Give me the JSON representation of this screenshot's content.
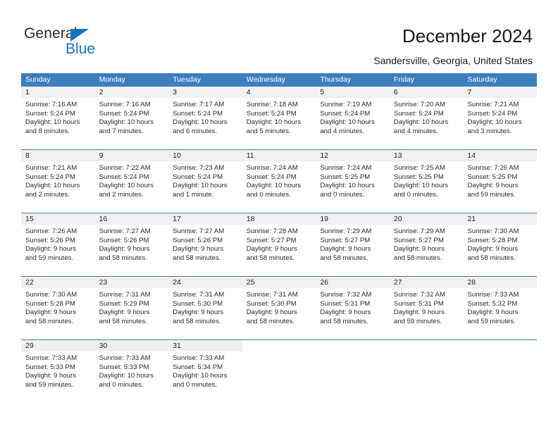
{
  "brand": {
    "name_part1": "General",
    "name_part2": "Blue",
    "logo_icon": "blue-triangle-icon",
    "primary_color": "#1574bb"
  },
  "header": {
    "title": "December 2024",
    "subtitle": "Sandersville, Georgia, United States"
  },
  "calendar": {
    "header_color": "#3d7ebe",
    "daynum_band_color": "#f0f0f0",
    "weekdays": [
      "Sunday",
      "Monday",
      "Tuesday",
      "Wednesday",
      "Thursday",
      "Friday",
      "Saturday"
    ],
    "weeks": [
      [
        {
          "day": "1",
          "sunrise": "Sunrise: 7:16 AM",
          "sunset": "Sunset: 5:24 PM",
          "daylight1": "Daylight: 10 hours",
          "daylight2": "and 8 minutes."
        },
        {
          "day": "2",
          "sunrise": "Sunrise: 7:16 AM",
          "sunset": "Sunset: 5:24 PM",
          "daylight1": "Daylight: 10 hours",
          "daylight2": "and 7 minutes."
        },
        {
          "day": "3",
          "sunrise": "Sunrise: 7:17 AM",
          "sunset": "Sunset: 5:24 PM",
          "daylight1": "Daylight: 10 hours",
          "daylight2": "and 6 minutes."
        },
        {
          "day": "4",
          "sunrise": "Sunrise: 7:18 AM",
          "sunset": "Sunset: 5:24 PM",
          "daylight1": "Daylight: 10 hours",
          "daylight2": "and 5 minutes."
        },
        {
          "day": "5",
          "sunrise": "Sunrise: 7:19 AM",
          "sunset": "Sunset: 5:24 PM",
          "daylight1": "Daylight: 10 hours",
          "daylight2": "and 4 minutes."
        },
        {
          "day": "6",
          "sunrise": "Sunrise: 7:20 AM",
          "sunset": "Sunset: 5:24 PM",
          "daylight1": "Daylight: 10 hours",
          "daylight2": "and 4 minutes."
        },
        {
          "day": "7",
          "sunrise": "Sunrise: 7:21 AM",
          "sunset": "Sunset: 5:24 PM",
          "daylight1": "Daylight: 10 hours",
          "daylight2": "and 3 minutes."
        }
      ],
      [
        {
          "day": "8",
          "sunrise": "Sunrise: 7:21 AM",
          "sunset": "Sunset: 5:24 PM",
          "daylight1": "Daylight: 10 hours",
          "daylight2": "and 2 minutes."
        },
        {
          "day": "9",
          "sunrise": "Sunrise: 7:22 AM",
          "sunset": "Sunset: 5:24 PM",
          "daylight1": "Daylight: 10 hours",
          "daylight2": "and 2 minutes."
        },
        {
          "day": "10",
          "sunrise": "Sunrise: 7:23 AM",
          "sunset": "Sunset: 5:24 PM",
          "daylight1": "Daylight: 10 hours",
          "daylight2": "and 1 minute."
        },
        {
          "day": "11",
          "sunrise": "Sunrise: 7:24 AM",
          "sunset": "Sunset: 5:24 PM",
          "daylight1": "Daylight: 10 hours",
          "daylight2": "and 0 minutes."
        },
        {
          "day": "12",
          "sunrise": "Sunrise: 7:24 AM",
          "sunset": "Sunset: 5:25 PM",
          "daylight1": "Daylight: 10 hours",
          "daylight2": "and 0 minutes."
        },
        {
          "day": "13",
          "sunrise": "Sunrise: 7:25 AM",
          "sunset": "Sunset: 5:25 PM",
          "daylight1": "Daylight: 10 hours",
          "daylight2": "and 0 minutes."
        },
        {
          "day": "14",
          "sunrise": "Sunrise: 7:26 AM",
          "sunset": "Sunset: 5:25 PM",
          "daylight1": "Daylight: 9 hours",
          "daylight2": "and 59 minutes."
        }
      ],
      [
        {
          "day": "15",
          "sunrise": "Sunrise: 7:26 AM",
          "sunset": "Sunset: 5:26 PM",
          "daylight1": "Daylight: 9 hours",
          "daylight2": "and 59 minutes."
        },
        {
          "day": "16",
          "sunrise": "Sunrise: 7:27 AM",
          "sunset": "Sunset: 5:26 PM",
          "daylight1": "Daylight: 9 hours",
          "daylight2": "and 58 minutes."
        },
        {
          "day": "17",
          "sunrise": "Sunrise: 7:27 AM",
          "sunset": "Sunset: 5:26 PM",
          "daylight1": "Daylight: 9 hours",
          "daylight2": "and 58 minutes."
        },
        {
          "day": "18",
          "sunrise": "Sunrise: 7:28 AM",
          "sunset": "Sunset: 5:27 PM",
          "daylight1": "Daylight: 9 hours",
          "daylight2": "and 58 minutes."
        },
        {
          "day": "19",
          "sunrise": "Sunrise: 7:29 AM",
          "sunset": "Sunset: 5:27 PM",
          "daylight1": "Daylight: 9 hours",
          "daylight2": "and 58 minutes."
        },
        {
          "day": "20",
          "sunrise": "Sunrise: 7:29 AM",
          "sunset": "Sunset: 5:27 PM",
          "daylight1": "Daylight: 9 hours",
          "daylight2": "and 58 minutes."
        },
        {
          "day": "21",
          "sunrise": "Sunrise: 7:30 AM",
          "sunset": "Sunset: 5:28 PM",
          "daylight1": "Daylight: 9 hours",
          "daylight2": "and 58 minutes."
        }
      ],
      [
        {
          "day": "22",
          "sunrise": "Sunrise: 7:30 AM",
          "sunset": "Sunset: 5:28 PM",
          "daylight1": "Daylight: 9 hours",
          "daylight2": "and 58 minutes."
        },
        {
          "day": "23",
          "sunrise": "Sunrise: 7:31 AM",
          "sunset": "Sunset: 5:29 PM",
          "daylight1": "Daylight: 9 hours",
          "daylight2": "and 58 minutes."
        },
        {
          "day": "24",
          "sunrise": "Sunrise: 7:31 AM",
          "sunset": "Sunset: 5:30 PM",
          "daylight1": "Daylight: 9 hours",
          "daylight2": "and 58 minutes."
        },
        {
          "day": "25",
          "sunrise": "Sunrise: 7:31 AM",
          "sunset": "Sunset: 5:30 PM",
          "daylight1": "Daylight: 9 hours",
          "daylight2": "and 58 minutes."
        },
        {
          "day": "26",
          "sunrise": "Sunrise: 7:32 AM",
          "sunset": "Sunset: 5:31 PM",
          "daylight1": "Daylight: 9 hours",
          "daylight2": "and 58 minutes."
        },
        {
          "day": "27",
          "sunrise": "Sunrise: 7:32 AM",
          "sunset": "Sunset: 5:31 PM",
          "daylight1": "Daylight: 9 hours",
          "daylight2": "and 59 minutes."
        },
        {
          "day": "28",
          "sunrise": "Sunrise: 7:33 AM",
          "sunset": "Sunset: 5:32 PM",
          "daylight1": "Daylight: 9 hours",
          "daylight2": "and 59 minutes."
        }
      ],
      [
        {
          "day": "29",
          "sunrise": "Sunrise: 7:33 AM",
          "sunset": "Sunset: 5:33 PM",
          "daylight1": "Daylight: 9 hours",
          "daylight2": "and 59 minutes."
        },
        {
          "day": "30",
          "sunrise": "Sunrise: 7:33 AM",
          "sunset": "Sunset: 5:33 PM",
          "daylight1": "Daylight: 10 hours",
          "daylight2": "and 0 minutes."
        },
        {
          "day": "31",
          "sunrise": "Sunrise: 7:33 AM",
          "sunset": "Sunset: 5:34 PM",
          "daylight1": "Daylight: 10 hours",
          "daylight2": "and 0 minutes."
        },
        {
          "day": "",
          "sunrise": "",
          "sunset": "",
          "daylight1": "",
          "daylight2": ""
        },
        {
          "day": "",
          "sunrise": "",
          "sunset": "",
          "daylight1": "",
          "daylight2": ""
        },
        {
          "day": "",
          "sunrise": "",
          "sunset": "",
          "daylight1": "",
          "daylight2": ""
        },
        {
          "day": "",
          "sunrise": "",
          "sunset": "",
          "daylight1": "",
          "daylight2": ""
        }
      ]
    ]
  }
}
